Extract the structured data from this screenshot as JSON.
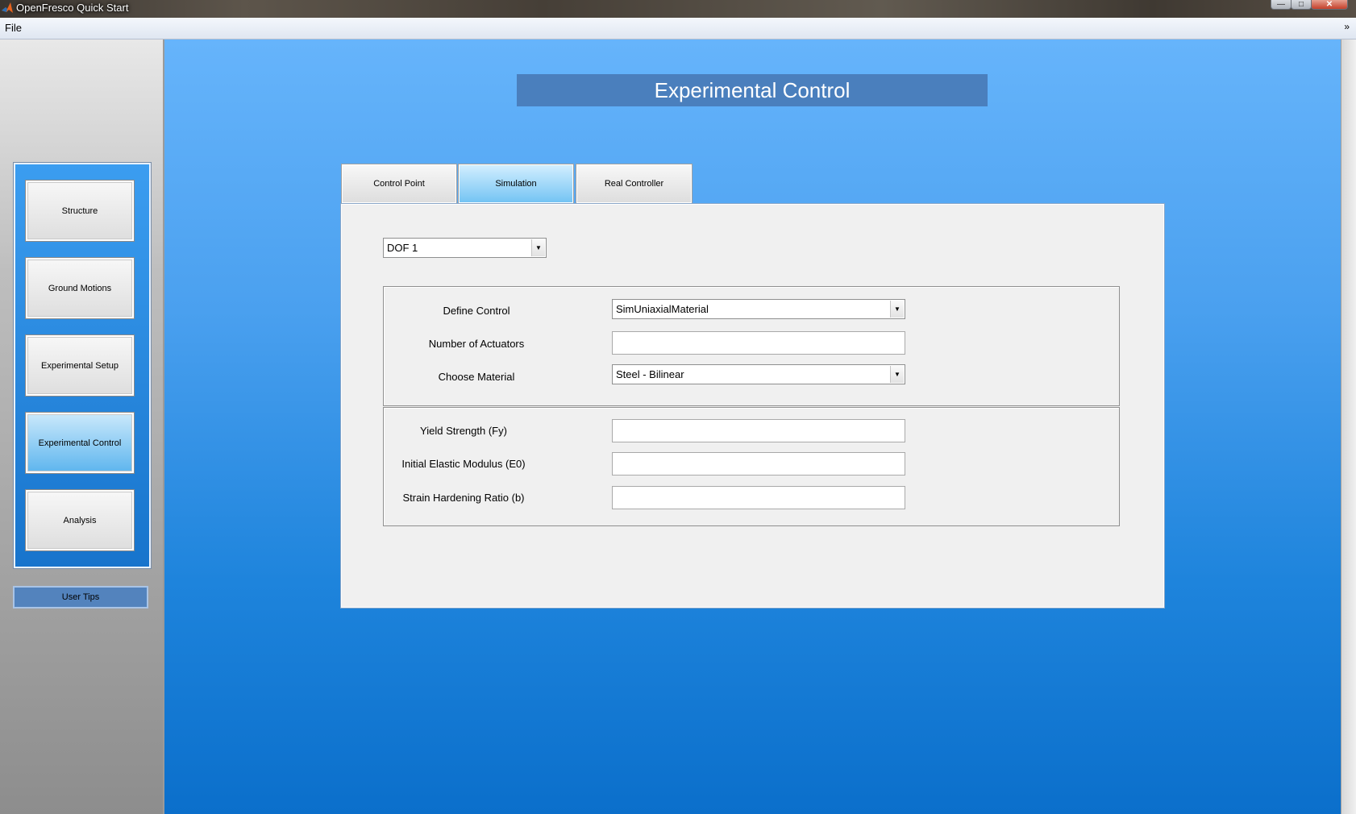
{
  "window": {
    "title": "OpenFresco Quick Start",
    "controls": {
      "minimize": "—",
      "maximize": "□",
      "close": "✕"
    }
  },
  "menu": {
    "file": "File",
    "overflow": "»"
  },
  "sidebar": {
    "items": [
      {
        "label": "Structure",
        "active": false
      },
      {
        "label": "Ground Motions",
        "active": false
      },
      {
        "label": "Experimental Setup",
        "active": false
      },
      {
        "label": "Experimental Control",
        "active": true
      },
      {
        "label": "Analysis",
        "active": false
      }
    ],
    "user_tips": "User Tips"
  },
  "main": {
    "title": "Experimental Control",
    "tabs": [
      {
        "label": "Control Point",
        "active": false
      },
      {
        "label": "Simulation",
        "active": true
      },
      {
        "label": "Real Controller",
        "active": false
      }
    ],
    "dof_select": {
      "value": "DOF 1"
    },
    "control_group": {
      "define_control_label": "Define Control",
      "define_control_value": "SimUniaxialMaterial",
      "num_actuators_label": "Number of Actuators",
      "num_actuators_value": "",
      "choose_material_label": "Choose Material",
      "choose_material_value": "Steel - Bilinear"
    },
    "material_group": {
      "yield_strength_label": "Yield Strength (Fy)",
      "yield_strength_value": "",
      "elastic_modulus_label": "Initial Elastic Modulus (E0)",
      "elastic_modulus_value": "",
      "hardening_ratio_label": "Strain Hardening Ratio (b)",
      "hardening_ratio_value": ""
    }
  },
  "colors": {
    "accent_blue": "#4a7fbd",
    "active_button": "#72c3f3",
    "nav_box": "#1774cc"
  }
}
